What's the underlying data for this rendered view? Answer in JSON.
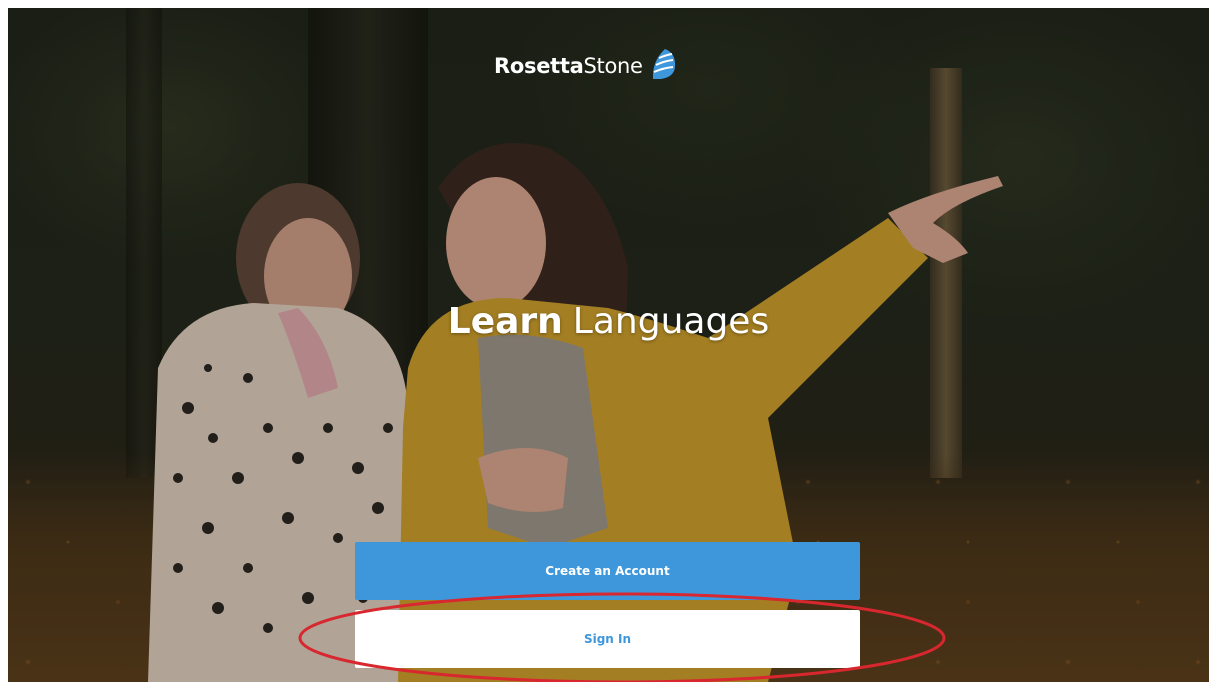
{
  "header": {
    "logo_text_bold": "Rosetta",
    "logo_text_light": "Stone",
    "logo_icon": "rosetta-stone-logo-icon"
  },
  "hero": {
    "heading_bold": "Learn",
    "heading_light": "Languages"
  },
  "actions": {
    "create_account_label": "Create an Account",
    "sign_in_label": "Sign In"
  },
  "colors": {
    "accent": "#3f97db",
    "highlight_ring": "#d8272e",
    "button_text_light": "#ffffff"
  }
}
